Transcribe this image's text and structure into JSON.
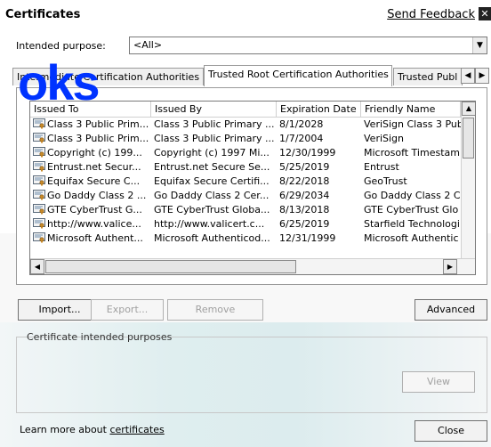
{
  "window": {
    "title": "Certificates",
    "feedback_link": "Send Feedback",
    "close_glyph": "✕"
  },
  "intended_purpose": {
    "label": "Intended purpose:",
    "value": "<All>"
  },
  "watermark_text": "oks",
  "tabs": [
    {
      "label": "Intermediate Certification Authorities",
      "active": false
    },
    {
      "label": "Trusted Root Certification Authorities",
      "active": true
    },
    {
      "label": "Trusted Publ",
      "active": false
    }
  ],
  "table": {
    "columns": [
      "Issued To",
      "Issued By",
      "Expiration Date",
      "Friendly Name"
    ],
    "rows": [
      [
        "Class 3 Public Prim...",
        "Class 3 Public Primary ...",
        "8/1/2028",
        "VeriSign Class 3 Pub"
      ],
      [
        "Class 3 Public Prim...",
        "Class 3 Public Primary ...",
        "1/7/2004",
        "VeriSign"
      ],
      [
        "Copyright (c) 199...",
        "Copyright (c) 1997 Mi...",
        "12/30/1999",
        "Microsoft Timestamp"
      ],
      [
        "Entrust.net Secur...",
        "Entrust.net Secure Se...",
        "5/25/2019",
        "Entrust"
      ],
      [
        "Equifax Secure C...",
        "Equifax Secure Certifi...",
        "8/22/2018",
        "GeoTrust"
      ],
      [
        "Go Daddy Class 2 ...",
        "Go Daddy Class 2 Cer...",
        "6/29/2034",
        "Go Daddy Class 2 C"
      ],
      [
        "GTE CyberTrust G...",
        "GTE CyberTrust Globa...",
        "8/13/2018",
        "GTE CyberTrust Glo"
      ],
      [
        "http://www.valice...",
        "http://www.valicert.c...",
        "6/25/2019",
        "Starfield Technologi"
      ],
      [
        "Microsoft Authent...",
        "Microsoft Authenticod...",
        "12/31/1999",
        "Microsoft Authentic"
      ]
    ]
  },
  "buttons": {
    "import": "Import...",
    "export": "Export...",
    "remove": "Remove",
    "advanced": "Advanced",
    "view": "View",
    "close": "Close"
  },
  "purposes_group": {
    "label": "Certificate intended purposes"
  },
  "footer": {
    "learn_prefix": "Learn more about ",
    "learn_link": "certificates"
  },
  "icons": {
    "certificate": "certificate-icon",
    "dropdown": "chevron-down-icon",
    "tab_left": "chevron-left-icon",
    "tab_right": "chevron-right-icon",
    "close": "close-icon"
  }
}
